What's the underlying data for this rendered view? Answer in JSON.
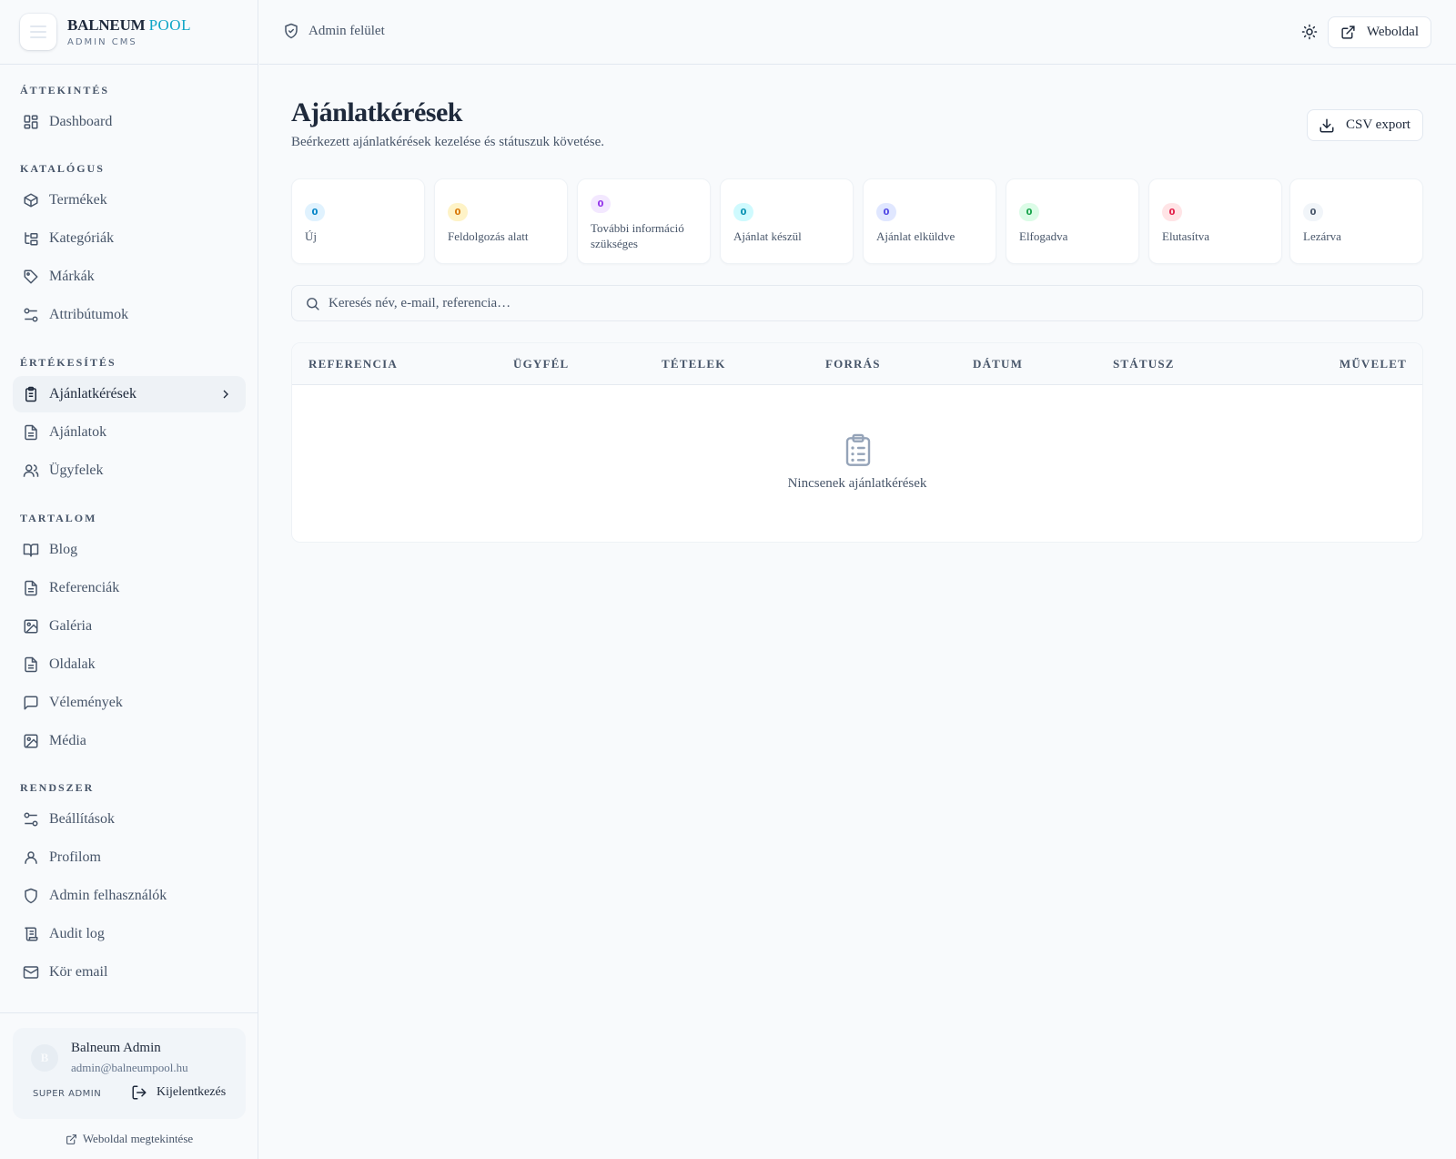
{
  "brand": {
    "name_a": "BALNEUM",
    "name_b": "POOL",
    "sub": "ADMIN CMS"
  },
  "topbar": {
    "breadcrumb": "Admin felület",
    "site_button": "Weboldal"
  },
  "sidebar": {
    "sections": [
      {
        "label": "ÁTTEKINTÉS"
      },
      {
        "label": "KATALÓGUS"
      },
      {
        "label": "ÉRTÉKESÍTÉS"
      },
      {
        "label": "TARTALOM"
      },
      {
        "label": "RENDSZER"
      }
    ],
    "items": [
      {
        "label": "Dashboard",
        "icon": "dashboard-icon"
      },
      {
        "label": "Termékek",
        "icon": "box-icon"
      },
      {
        "label": "Kategóriák",
        "icon": "folder-tree-icon"
      },
      {
        "label": "Márkák",
        "icon": "tag-icon"
      },
      {
        "label": "Attribútumok",
        "icon": "sliders-icon"
      },
      {
        "label": "Ajánlatkérések",
        "icon": "clipboard-list-icon",
        "active": true
      },
      {
        "label": "Ajánlatok",
        "icon": "document-icon"
      },
      {
        "label": "Ügyfelek",
        "icon": "users-icon"
      },
      {
        "label": "Blog",
        "icon": "book-icon"
      },
      {
        "label": "Referenciák",
        "icon": "document-icon"
      },
      {
        "label": "Galéria",
        "icon": "image-icon"
      },
      {
        "label": "Oldalak",
        "icon": "document-icon"
      },
      {
        "label": "Vélemények",
        "icon": "message-icon"
      },
      {
        "label": "Média",
        "icon": "image-icon"
      },
      {
        "label": "Beállítások",
        "icon": "sliders-icon"
      },
      {
        "label": "Profilom",
        "icon": "user-icon"
      },
      {
        "label": "Admin felhasználók",
        "icon": "shield-icon"
      },
      {
        "label": "Audit log",
        "icon": "scroll-icon"
      },
      {
        "label": "Kör email",
        "icon": "mail-icon"
      }
    ]
  },
  "user": {
    "name": "Balneum Admin",
    "email": "admin@balneumpool.hu",
    "role": "SUPER ADMIN",
    "logout": "Kijelentkezés",
    "view_site": "Weboldal megtekintése"
  },
  "page": {
    "title": "Ajánlatkérések",
    "subtitle": "Beérkezett ajánlatkérések kezelése és státuszuk követése.",
    "csv_button": "CSV export"
  },
  "stats": [
    {
      "count": "0",
      "label": "Új",
      "bg": "#e0f2fe",
      "fg": "#0284c7"
    },
    {
      "count": "0",
      "label": "Feldolgozás alatt",
      "bg": "#fef3c7",
      "fg": "#d97706"
    },
    {
      "count": "0",
      "label": "További információ szükséges",
      "bg": "#f3e8ff",
      "fg": "#9333ea"
    },
    {
      "count": "0",
      "label": "Ajánlat készül",
      "bg": "#cffafe",
      "fg": "#0891b2"
    },
    {
      "count": "0",
      "label": "Ajánlat elküldve",
      "bg": "#e0e7ff",
      "fg": "#4f46e5"
    },
    {
      "count": "0",
      "label": "Elfogadva",
      "bg": "#dcfce7",
      "fg": "#16a34a"
    },
    {
      "count": "0",
      "label": "Elutasítva",
      "bg": "#ffe4e6",
      "fg": "#e11d48"
    },
    {
      "count": "0",
      "label": "Lezárva",
      "bg": "#f1f5f9",
      "fg": "#475569"
    }
  ],
  "search": {
    "placeholder": "Keresés név, e-mail, referencia…"
  },
  "table": {
    "columns": [
      "REFERENCIA",
      "ÜGYFÉL",
      "TÉTELEK",
      "FORRÁS",
      "DÁTUM",
      "STÁTUSZ",
      "MŰVELET"
    ],
    "empty_text": "Nincsenek ajánlatkérések"
  },
  "colors": {
    "accent": "#0ea5c6",
    "text": "#1e293b",
    "muted": "#475569"
  }
}
